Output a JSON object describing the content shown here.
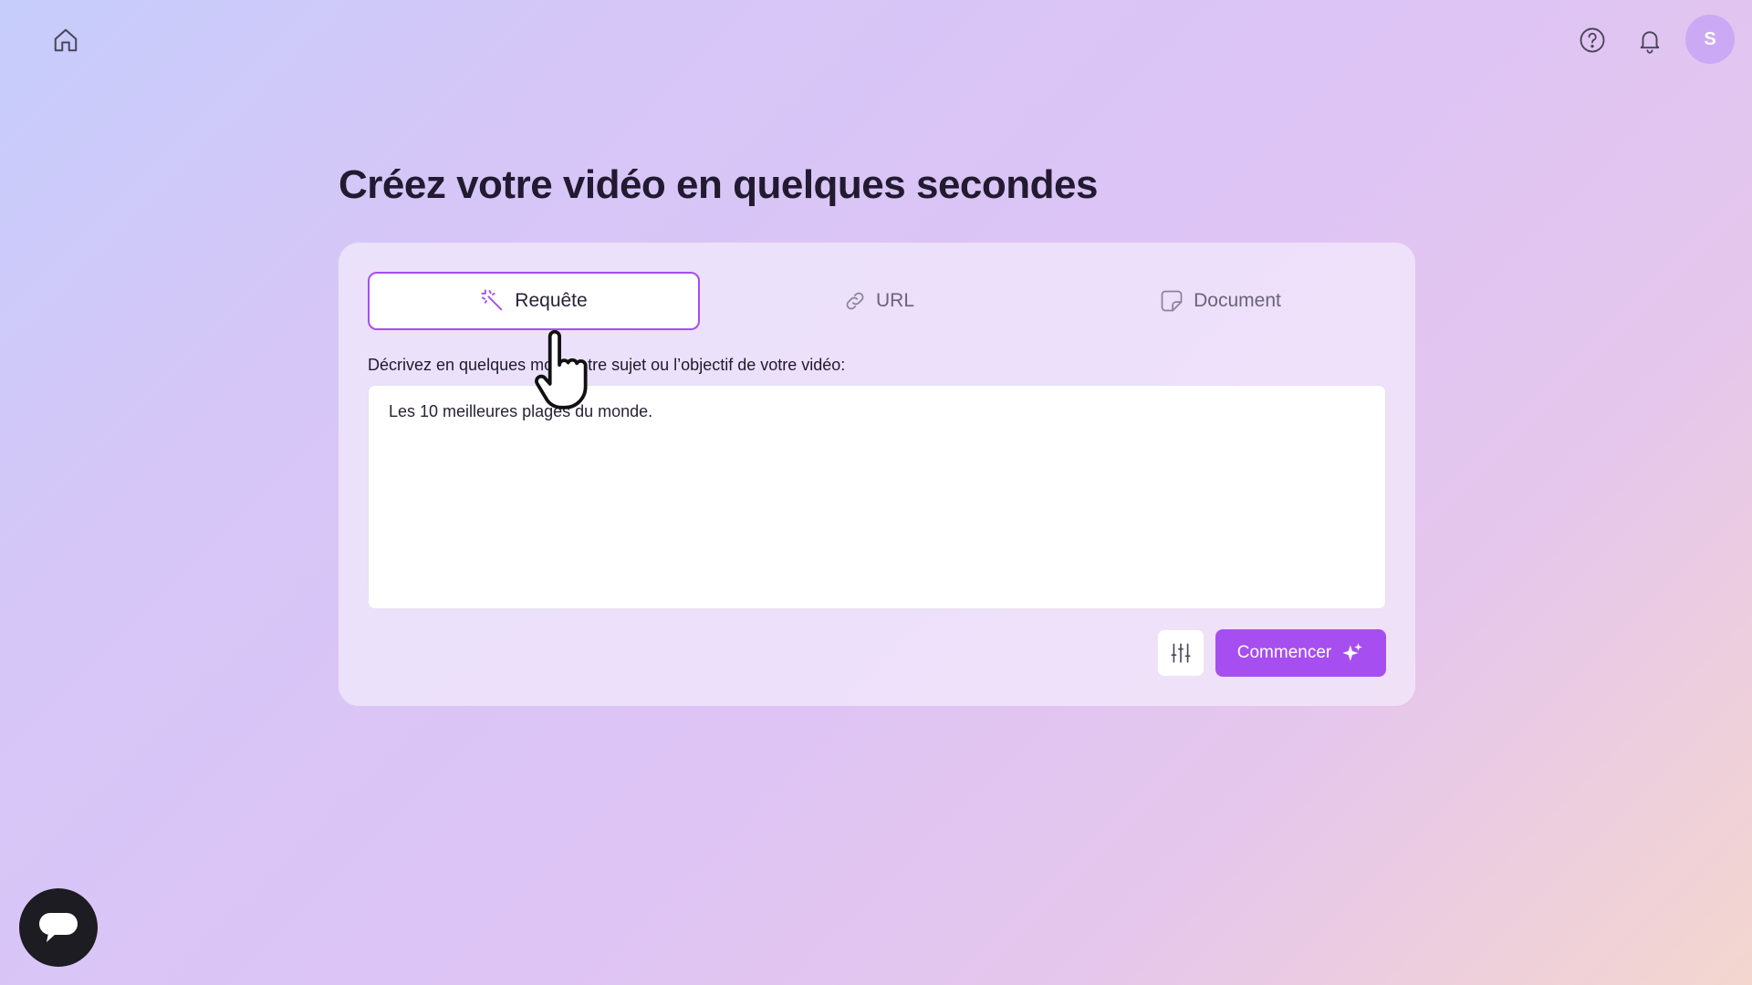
{
  "topbar": {
    "home_icon": "home-icon",
    "help_icon": "help-circle-icon",
    "notifications_icon": "bell-icon",
    "avatar_initial": "S"
  },
  "page": {
    "title": "Créez votre vidéo en quelques secondes"
  },
  "tabs": [
    {
      "label": "Requête",
      "icon": "magic-wand-icon",
      "active": true
    },
    {
      "label": "URL",
      "icon": "link-icon",
      "active": false
    },
    {
      "label": "Document",
      "icon": "document-icon",
      "active": false
    }
  ],
  "prompt": {
    "label": "Décrivez en quelques mots votre sujet ou l’objectif de votre vidéo:",
    "value": "Les 10 meilleures plages du monde."
  },
  "actions": {
    "settings_icon": "sliders-icon",
    "start_label": "Commencer",
    "start_icon": "sparkles-icon"
  },
  "colors": {
    "accent": "#a64ef0",
    "avatar_bg": "#cba9f4",
    "chat_bg": "#1c1c22"
  }
}
